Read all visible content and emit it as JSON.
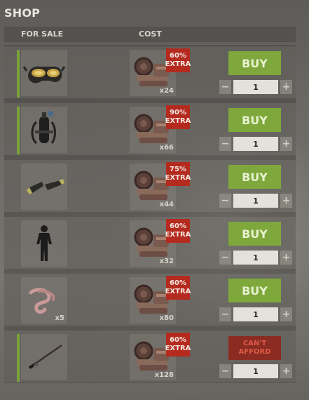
{
  "shop": {
    "title": "SHOP",
    "columns": {
      "for_sale": "FOR SALE",
      "cost": "COST"
    },
    "items": [
      {
        "name": "diving mask",
        "icon": "diving-mask-icon",
        "item_qty": "",
        "cost_icon": "metal-fragments-icon",
        "cost_qty": "x24",
        "extra_pct": "60%",
        "extra_label": "EXTRA",
        "action": "BUY",
        "affordable": true,
        "quantity": "1",
        "accent": true
      },
      {
        "name": "diving tank",
        "icon": "diving-tank-icon",
        "item_qty": "",
        "cost_icon": "metal-fragments-icon",
        "cost_qty": "x66",
        "extra_pct": "90%",
        "extra_label": "EXTRA",
        "action": "BUY",
        "affordable": true,
        "quantity": "1",
        "accent": true
      },
      {
        "name": "diving fins",
        "icon": "diving-fins-icon",
        "item_qty": "",
        "cost_icon": "metal-fragments-icon",
        "cost_qty": "x44",
        "extra_pct": "75%",
        "extra_label": "EXTRA",
        "action": "BUY",
        "affordable": true,
        "quantity": "1",
        "accent": false
      },
      {
        "name": "wetsuit",
        "icon": "wetsuit-icon",
        "item_qty": "",
        "cost_icon": "metal-fragments-icon",
        "cost_qty": "x32",
        "extra_pct": "60%",
        "extra_label": "EXTRA",
        "action": "BUY",
        "affordable": true,
        "quantity": "1",
        "accent": false
      },
      {
        "name": "worms",
        "icon": "worm-icon",
        "item_qty": "x5",
        "cost_icon": "metal-fragments-icon",
        "cost_qty": "x80",
        "extra_pct": "60%",
        "extra_label": "EXTRA",
        "action": "BUY",
        "affordable": true,
        "quantity": "1",
        "accent": false
      },
      {
        "name": "fishing rod",
        "icon": "fishing-rod-icon",
        "item_qty": "",
        "cost_icon": "metal-fragments-icon",
        "cost_qty": "x128",
        "extra_pct": "60%",
        "extra_label": "EXTRA",
        "action_line1": "CAN'T",
        "action_line2": "AFFORD",
        "affordable": false,
        "quantity": "1",
        "accent": true
      }
    ],
    "stepper": {
      "minus": "−",
      "plus": "+"
    },
    "colors": {
      "buy": "#7ea83c",
      "cant_afford": "#8a2c22",
      "extra": "#b42a1e",
      "accent": "#7aa23b"
    }
  }
}
